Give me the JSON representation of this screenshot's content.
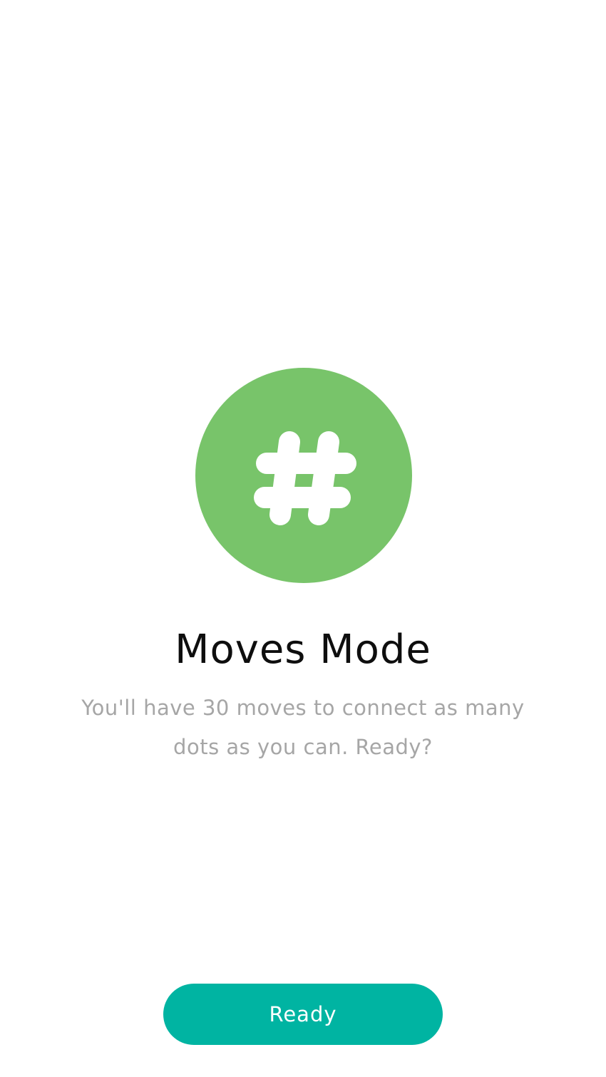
{
  "mode": {
    "icon": "hash-icon",
    "accent_color": "#78c46a",
    "title": "Moves Mode",
    "description": "You'll have 30 moves to connect as many dots as you can. Ready?"
  },
  "actions": {
    "ready_label": "Ready",
    "button_color": "#00b4a2"
  }
}
